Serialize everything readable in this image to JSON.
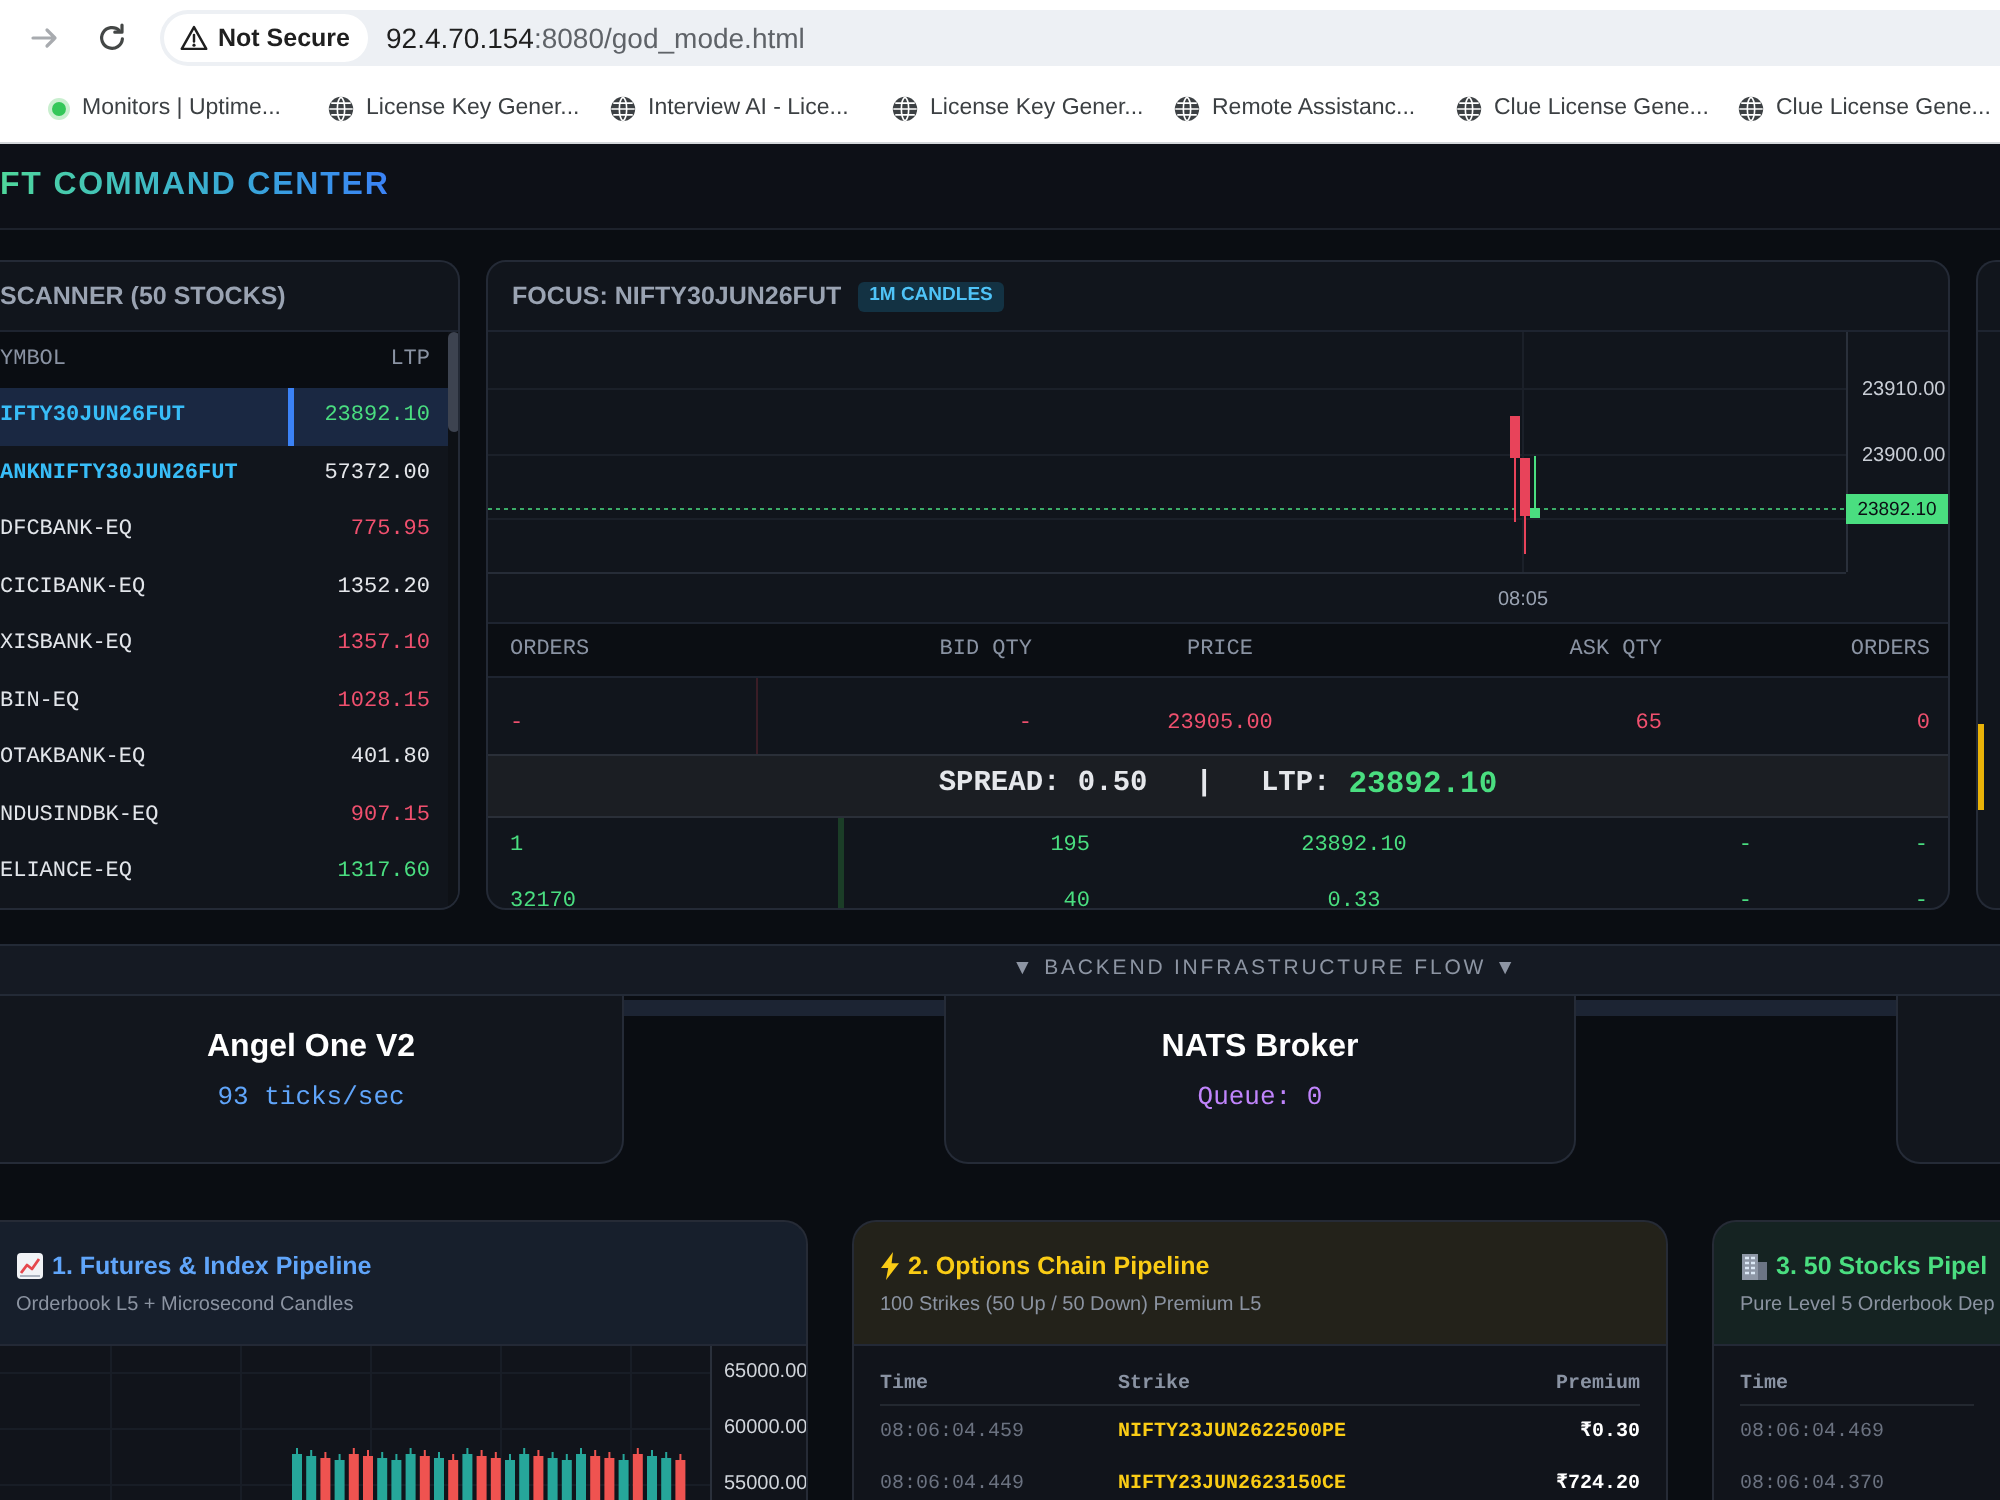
{
  "browser": {
    "address_bar": {
      "security_label": "Not Secure",
      "host": "92.4.70.154",
      "path": ":8080/god_mode.html"
    },
    "bookmarks": [
      {
        "label": "Monitors | Uptime...",
        "kind": "status"
      },
      {
        "label": "License Key Gener...",
        "kind": "site"
      },
      {
        "label": "Interview AI - Lice...",
        "kind": "site"
      },
      {
        "label": "License Key Gener...",
        "kind": "site"
      },
      {
        "label": "Remote Assistanc...",
        "kind": "site"
      },
      {
        "label": "Clue License Gene...",
        "kind": "site"
      },
      {
        "label": "Clue License Gene...",
        "kind": "site"
      }
    ]
  },
  "header": {
    "title": "FT COMMAND CENTER"
  },
  "scanner": {
    "title": "SCANNER (50 STOCKS)",
    "columns": [
      "YMBOL",
      "LTP"
    ],
    "rows": [
      {
        "symbol": "IFTY30JUN26FUT",
        "ltp": "23892.10",
        "kind": "future",
        "color": "#4ade80",
        "selected": true
      },
      {
        "symbol": "ANKNIFTY30JUN26FUT",
        "ltp": "57372.00",
        "kind": "future",
        "color": "#e5e7eb",
        "selected": false
      },
      {
        "symbol": "DFCBANK-EQ",
        "ltp": "775.95",
        "kind": "stock",
        "color": "#f0506e",
        "selected": false
      },
      {
        "symbol": "CICIBANK-EQ",
        "ltp": "1352.20",
        "kind": "stock",
        "color": "#e5e7eb",
        "selected": false
      },
      {
        "symbol": "XISBANK-EQ",
        "ltp": "1357.10",
        "kind": "stock",
        "color": "#f0506e",
        "selected": false
      },
      {
        "symbol": "BIN-EQ",
        "ltp": "1028.15",
        "kind": "stock",
        "color": "#f0506e",
        "selected": false
      },
      {
        "symbol": "OTAKBANK-EQ",
        "ltp": "401.80",
        "kind": "stock",
        "color": "#e5e7eb",
        "selected": false
      },
      {
        "symbol": "NDUSINDBK-EQ",
        "ltp": "907.15",
        "kind": "stock",
        "color": "#f0506e",
        "selected": false
      },
      {
        "symbol": "ELIANCE-EQ",
        "ltp": "1317.60",
        "kind": "stock",
        "color": "#4ade80",
        "selected": false
      }
    ]
  },
  "focus": {
    "title": "FOCUS: NIFTY30JUN26FUT",
    "badge": "1M CANDLES",
    "chart": {
      "y_labels": [
        "23910.00",
        "23900.00"
      ],
      "x_labels": [
        "08:05"
      ],
      "last_price": "23892.10"
    },
    "orderbook": {
      "columns": [
        "ORDERS",
        "BID QTY",
        "PRICE",
        "ASK QTY",
        "ORDERS"
      ],
      "asks": [
        [
          "-",
          "-",
          "23905.00",
          "65",
          "0"
        ]
      ],
      "spread": "SPREAD: 0.50",
      "separator": "|",
      "ltp_label": "LTP:",
      "ltp": "23892.10",
      "bids": [
        [
          "1",
          "195",
          "23892.10",
          "-",
          "-"
        ],
        [
          "32170",
          "40",
          "0.33",
          "-",
          "-"
        ]
      ]
    }
  },
  "infrastructure": {
    "title": "▼ BACKEND INFRASTRUCTURE FLOW ▼",
    "nodes": [
      {
        "name": "Angel One V2",
        "metric": "93 ticks/sec",
        "color": "#60a5fa"
      },
      {
        "name": "NATS Broker",
        "metric": "Queue: 0",
        "color": "#c084fc"
      }
    ]
  },
  "pipelines": [
    {
      "kind": "futures",
      "title": "1. Futures & Index Pipeline",
      "subtitle": "Orderbook L5 + Microsecond Candles",
      "color": "#60a5fa",
      "chart": {
        "y_labels": [
          "65000.00",
          "60000.00",
          "55000.00"
        ]
      }
    },
    {
      "kind": "options",
      "title": "2. Options Chain Pipeline",
      "subtitle": "100 Strikes (50 Up / 50 Down) Premium L5",
      "color": "#facc15",
      "table": {
        "columns": [
          "Time",
          "Strike",
          "Premium"
        ],
        "rows": [
          [
            "08:06:04.459",
            "NIFTY23JUN2622500PE",
            "₹0.30"
          ],
          [
            "08:06:04.449",
            "NIFTY23JUN2623150CE",
            "₹724.20"
          ]
        ]
      }
    },
    {
      "kind": "stocks",
      "title": "3. 50 Stocks Pipel",
      "subtitle": "Pure Level 5 Orderbook Dep",
      "color": "#4ade80",
      "table": {
        "columns": [
          "Time"
        ],
        "rows": [
          [
            "08:06:04.469"
          ],
          [
            "08:06:04.370"
          ]
        ]
      }
    }
  ]
}
